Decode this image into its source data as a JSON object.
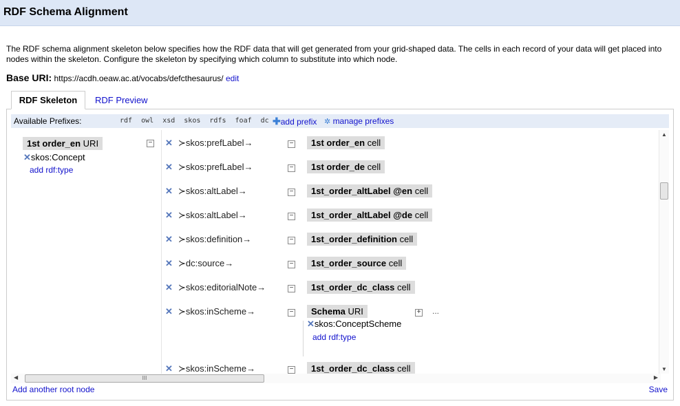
{
  "title": "RDF Schema Alignment",
  "description": "The RDF schema alignment skeleton below specifies how the RDF data that will get generated from your grid-shaped data. The cells in each record of your data will get placed into nodes within the skeleton. Configure the skeleton by specifying which column to substitute into which node.",
  "base_uri": {
    "label": "Base URI:",
    "value": "https://acdh.oeaw.ac.at/vocabs/defcthesaurus/",
    "edit": "edit"
  },
  "tabs": [
    {
      "label": "RDF Skeleton",
      "active": true
    },
    {
      "label": "RDF Preview",
      "active": false
    }
  ],
  "prefixes": {
    "label": "Available Prefixes:",
    "items": [
      "rdf",
      "owl",
      "xsd",
      "skos",
      "rdfs",
      "foaf",
      "dc"
    ],
    "add_prefix": "add prefix",
    "manage_prefixes": "manage prefixes"
  },
  "root_node": {
    "column": "1st order_en",
    "kind": "URI",
    "type": "skos:Concept",
    "add_type": "add rdf:type"
  },
  "links": [
    {
      "property": "skos:prefLabel",
      "column": "1st order_en",
      "kind": "cell"
    },
    {
      "property": "skos:prefLabel",
      "column": "1st order_de",
      "kind": "cell"
    },
    {
      "property": "skos:altLabel",
      "column": "1st_order_altLabel @en",
      "kind": "cell"
    },
    {
      "property": "skos:altLabel",
      "column": "1st_order_altLabel @de",
      "kind": "cell"
    },
    {
      "property": "skos:definition",
      "column": "1st_order_definition",
      "kind": "cell"
    },
    {
      "property": "dc:source",
      "column": "1st_order_source",
      "kind": "cell"
    },
    {
      "property": "skos:editorialNote",
      "column": "1st_order_dc_class",
      "kind": "cell"
    },
    {
      "property": "skos:inScheme",
      "column": "Schema",
      "kind": "URI",
      "type": "skos:ConceptScheme",
      "add_type": "add rdf:type",
      "more": "..."
    },
    {
      "property": "skos:inScheme",
      "column": "1st_order_dc_class",
      "kind": "cell"
    }
  ],
  "scrollbar": {
    "h_thumb_grip": "III"
  },
  "footer": {
    "add_root": "Add another root node",
    "save": "Save"
  },
  "glyphs": {
    "remove": "✕",
    "collapse": "−",
    "expand": "+",
    "arrow": "→",
    "lead": "≻",
    "add": "✚",
    "gear": "✲",
    "up": "▲",
    "down": "▼",
    "left": "◀",
    "right": "▶"
  },
  "colors": {
    "title_bg": "#dde7f6",
    "link": "#1111cc",
    "node_bg": "#dddddd",
    "prefix_bar": "#e5ecf7"
  }
}
